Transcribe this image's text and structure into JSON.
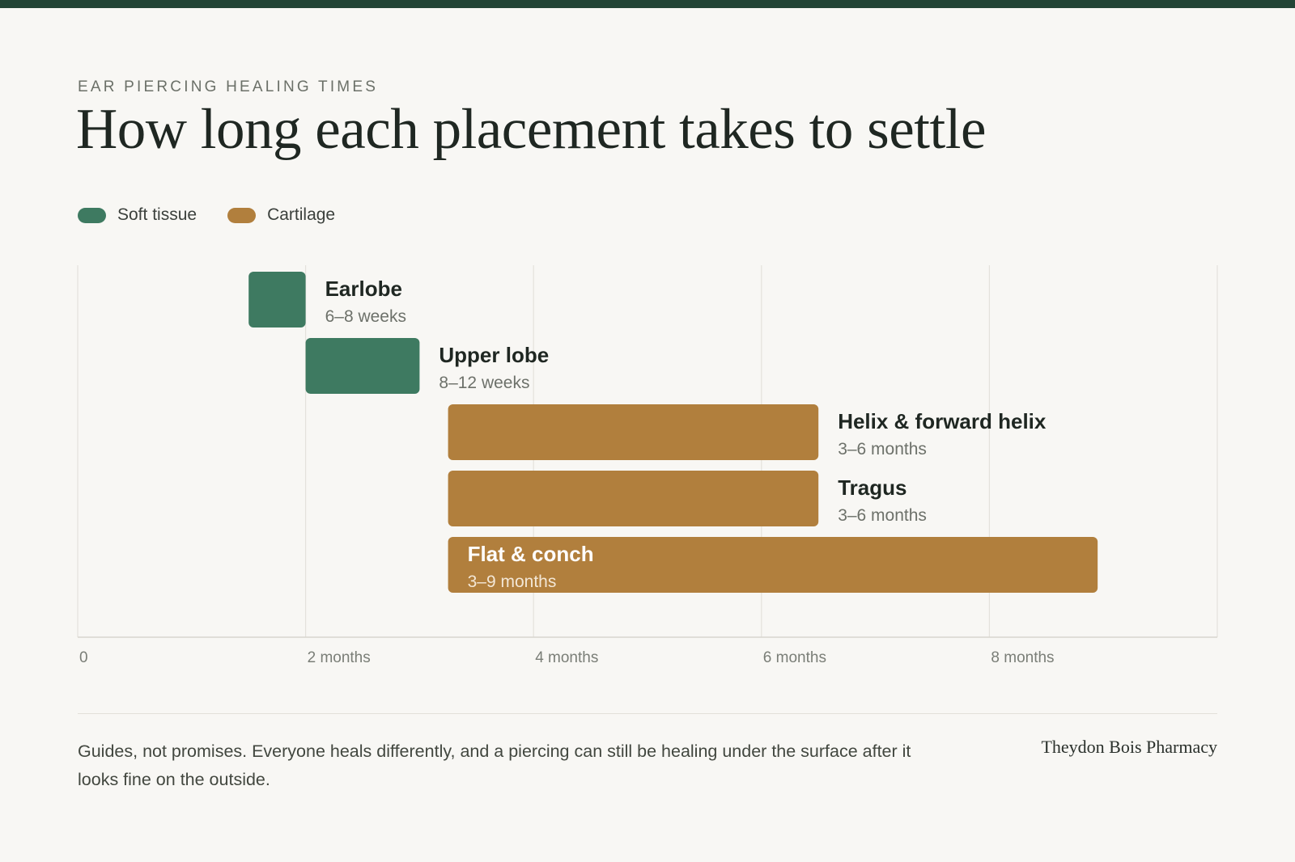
{
  "header": {
    "kicker": "EAR PIERCING HEALING TIMES",
    "title": "How long each placement takes to settle"
  },
  "legend": [
    {
      "label": "Soft tissue",
      "color": "#3e7a61"
    },
    {
      "label": "Cartilage",
      "color": "#b17f3d"
    }
  ],
  "chart_data": {
    "type": "bar",
    "orientation": "horizontal-range",
    "x_unit": "months",
    "xlim": [
      0,
      10
    ],
    "x_ticks": [
      {
        "value": 0,
        "label": "0"
      },
      {
        "value": 2,
        "label": "2 months"
      },
      {
        "value": 4,
        "label": "4 months"
      },
      {
        "value": 6,
        "label": "6 months"
      },
      {
        "value": 8,
        "label": "8 months"
      }
    ],
    "grid": true,
    "legend_placement": "top-left",
    "bars": [
      {
        "name": "Earlobe",
        "range_label": "6–8 weeks",
        "start": 1.5,
        "end": 2.0,
        "category": "Soft tissue",
        "label_position": "outside"
      },
      {
        "name": "Upper lobe",
        "range_label": "8–12 weeks",
        "start": 2.0,
        "end": 3.0,
        "category": "Soft tissue",
        "label_position": "outside"
      },
      {
        "name": "Helix & forward helix",
        "range_label": "3–6 months",
        "start": 3.25,
        "end": 6.5,
        "category": "Cartilage",
        "label_position": "outside"
      },
      {
        "name": "Tragus",
        "range_label": "3–6 months",
        "start": 3.25,
        "end": 6.5,
        "category": "Cartilage",
        "label_position": "outside"
      },
      {
        "name": "Flat & conch",
        "range_label": "3–9 months",
        "start": 3.25,
        "end": 8.95,
        "category": "Cartilage",
        "label_position": "inside"
      }
    ]
  },
  "footer": {
    "note": "Guides, not promises. Everyone heals differently, and a piercing can still be healing under the surface after it looks fine on the outside.",
    "brand": "Theydon Bois Pharmacy"
  }
}
